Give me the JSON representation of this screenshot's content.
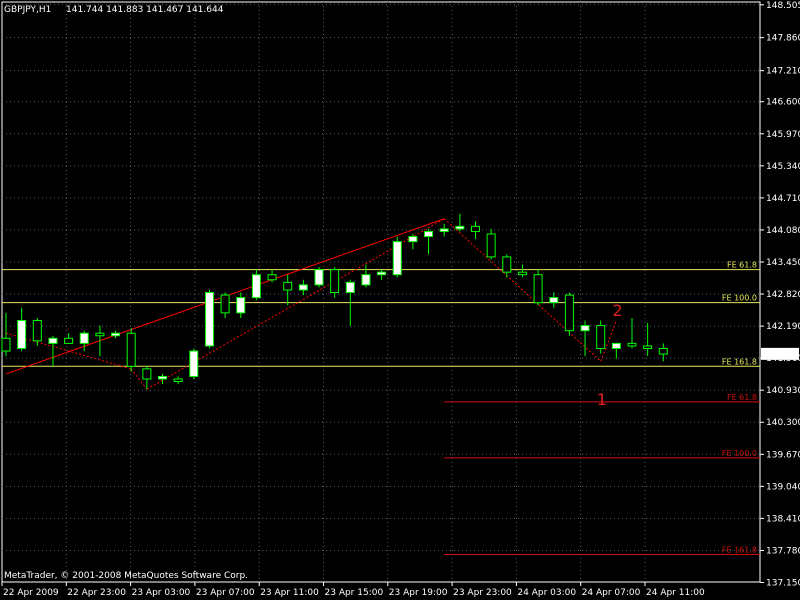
{
  "header": {
    "symbol_tf": "GBPJPY,H1",
    "quote": "141.744 141.883 141.467 141.644"
  },
  "copyright": "MetaTrader, © 2001-2008 MetaQuotes Software Corp.",
  "colors": {
    "background": "#000000",
    "bull": "#ffffff",
    "bear": "#000000",
    "wick": "#00ff00",
    "grid": "#506070",
    "axis_text": "#ffffff",
    "fe_yellow": "#e8e860",
    "fe_red": "#d01010",
    "trend": "#ff0000",
    "price_label_bg": "#ffffff",
    "price_label_fg": "#000000"
  },
  "chart_data": {
    "type": "candlestick",
    "ylim": [
      137.16,
      148.56
    ],
    "y_ticks": [
      "148.505",
      "147.860",
      "147.210",
      "146.600",
      "145.970",
      "145.340",
      "144.710",
      "144.080",
      "143.450",
      "142.820",
      "142.190",
      "141.560",
      "140.930",
      "140.300",
      "139.670",
      "139.040",
      "138.410",
      "137.780",
      "137.150"
    ],
    "x_ticks": [
      "22 Apr 2009",
      "22 Apr 23:00",
      "23 Apr 03:00",
      "23 Apr 07:00",
      "23 Apr 11:00",
      "23 Apr 15:00",
      "23 Apr 19:00",
      "23 Apr 23:00",
      "24 Apr 03:00",
      "24 Apr 07:00",
      "24 Apr 11:00"
    ],
    "current_price": "141.644",
    "candles": [
      {
        "o": 141.95,
        "h": 142.45,
        "l": 141.6,
        "c": 141.7
      },
      {
        "o": 141.75,
        "h": 142.55,
        "l": 141.7,
        "c": 142.3
      },
      {
        "o": 142.3,
        "h": 142.35,
        "l": 141.8,
        "c": 141.9
      },
      {
        "o": 141.85,
        "h": 142.0,
        "l": 141.4,
        "c": 141.95
      },
      {
        "o": 141.95,
        "h": 142.05,
        "l": 141.9,
        "c": 141.85
      },
      {
        "o": 141.85,
        "h": 142.1,
        "l": 141.7,
        "c": 142.05
      },
      {
        "o": 142.05,
        "h": 142.2,
        "l": 141.6,
        "c": 142.0
      },
      {
        "o": 142.0,
        "h": 142.1,
        "l": 141.95,
        "c": 142.05
      },
      {
        "o": 142.05,
        "h": 142.15,
        "l": 141.3,
        "c": 141.4
      },
      {
        "o": 141.35,
        "h": 141.4,
        "l": 140.95,
        "c": 141.15
      },
      {
        "o": 141.15,
        "h": 141.25,
        "l": 141.05,
        "c": 141.2
      },
      {
        "o": 141.15,
        "h": 141.2,
        "l": 141.05,
        "c": 141.1
      },
      {
        "o": 141.2,
        "h": 141.75,
        "l": 141.15,
        "c": 141.7
      },
      {
        "o": 141.8,
        "h": 142.9,
        "l": 141.75,
        "c": 142.85
      },
      {
        "o": 142.8,
        "h": 142.85,
        "l": 142.35,
        "c": 142.45
      },
      {
        "o": 142.45,
        "h": 142.85,
        "l": 142.35,
        "c": 142.75
      },
      {
        "o": 142.75,
        "h": 143.3,
        "l": 142.7,
        "c": 143.2
      },
      {
        "o": 143.2,
        "h": 143.3,
        "l": 143.05,
        "c": 143.1
      },
      {
        "o": 143.05,
        "h": 143.2,
        "l": 142.6,
        "c": 142.9
      },
      {
        "o": 142.9,
        "h": 143.1,
        "l": 142.8,
        "c": 143.0
      },
      {
        "o": 143.0,
        "h": 143.35,
        "l": 142.95,
        "c": 143.3
      },
      {
        "o": 143.3,
        "h": 143.35,
        "l": 142.75,
        "c": 142.85
      },
      {
        "o": 142.85,
        "h": 143.1,
        "l": 142.2,
        "c": 143.05
      },
      {
        "o": 143.0,
        "h": 143.4,
        "l": 142.95,
        "c": 143.2
      },
      {
        "o": 143.2,
        "h": 143.3,
        "l": 143.1,
        "c": 143.25
      },
      {
        "o": 143.2,
        "h": 143.95,
        "l": 143.15,
        "c": 143.85
      },
      {
        "o": 143.85,
        "h": 144.0,
        "l": 143.7,
        "c": 143.95
      },
      {
        "o": 143.95,
        "h": 144.1,
        "l": 143.6,
        "c": 144.05
      },
      {
        "o": 144.05,
        "h": 144.2,
        "l": 143.95,
        "c": 144.1
      },
      {
        "o": 144.1,
        "h": 144.4,
        "l": 144.05,
        "c": 144.15
      },
      {
        "o": 144.15,
        "h": 144.25,
        "l": 143.9,
        "c": 144.05
      },
      {
        "o": 144.0,
        "h": 144.1,
        "l": 143.5,
        "c": 143.55
      },
      {
        "o": 143.55,
        "h": 143.6,
        "l": 143.15,
        "c": 143.25
      },
      {
        "o": 143.25,
        "h": 143.4,
        "l": 143.15,
        "c": 143.2
      },
      {
        "o": 143.2,
        "h": 143.3,
        "l": 142.6,
        "c": 142.65
      },
      {
        "o": 142.65,
        "h": 142.85,
        "l": 142.55,
        "c": 142.75
      },
      {
        "o": 142.8,
        "h": 142.85,
        "l": 142.0,
        "c": 142.1
      },
      {
        "o": 142.1,
        "h": 142.3,
        "l": 141.6,
        "c": 142.2
      },
      {
        "o": 142.2,
        "h": 142.3,
        "l": 141.65,
        "c": 141.75
      },
      {
        "o": 141.75,
        "h": 141.85,
        "l": 141.55,
        "c": 141.85
      },
      {
        "o": 141.85,
        "h": 142.35,
        "l": 141.75,
        "c": 141.8
      },
      {
        "o": 141.8,
        "h": 142.25,
        "l": 141.6,
        "c": 141.75
      },
      {
        "o": 141.75,
        "h": 141.85,
        "l": 141.5,
        "c": 141.64
      }
    ],
    "fe_levels": [
      {
        "label": "FE 61.8",
        "price": 143.3,
        "color": "yellow",
        "from_candle": 0
      },
      {
        "label": "FE 100.0",
        "price": 142.65,
        "color": "yellow",
        "from_candle": 0
      },
      {
        "label": "FE 161.8",
        "price": 141.4,
        "color": "yellow",
        "from_candle": 0
      },
      {
        "label": "FE 61.8",
        "price": 140.7,
        "color": "red",
        "from_candle": 28
      },
      {
        "label": "FE 100.0",
        "price": 139.6,
        "color": "red",
        "from_candle": 28
      },
      {
        "label": "FE 161.8",
        "price": 137.7,
        "color": "red",
        "from_candle": 28
      }
    ],
    "trend_solid": [
      {
        "candle": 0,
        "price": 141.25
      },
      {
        "candle": 28,
        "price": 144.3
      }
    ],
    "trend_dotted": [
      {
        "candle": 0,
        "price": 142.05
      },
      {
        "candle": 8,
        "price": 141.35
      },
      {
        "candle": 8,
        "price": 141.35
      },
      {
        "candle": 9,
        "price": 140.95
      },
      {
        "candle": 9,
        "price": 140.95
      },
      {
        "candle": 28,
        "price": 144.3
      },
      {
        "candle": 28,
        "price": 144.3
      },
      {
        "candle": 38,
        "price": 141.5
      },
      {
        "candle": 38,
        "price": 141.5
      },
      {
        "candle": 39,
        "price": 142.3
      }
    ],
    "wave_labels": [
      {
        "text": "1",
        "candle": 38,
        "price": 140.95
      },
      {
        "text": "2",
        "candle": 39,
        "price": 142.7
      }
    ]
  }
}
